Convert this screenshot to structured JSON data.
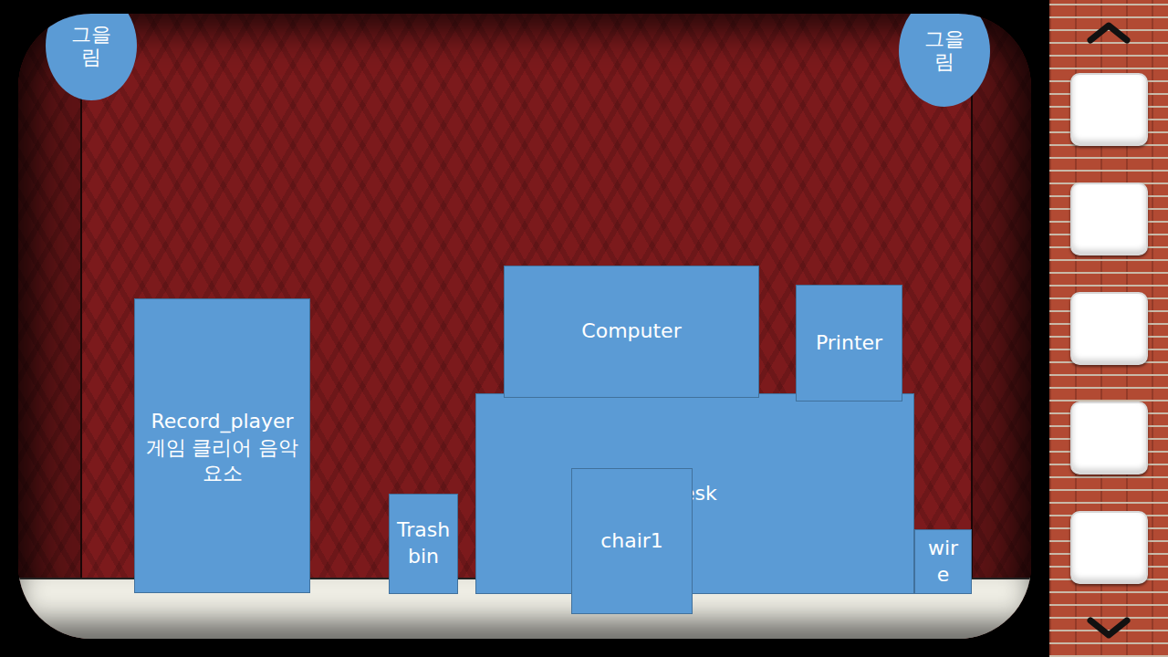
{
  "corner_marks": [
    {
      "label": "그을림"
    },
    {
      "label": "그을림"
    }
  ],
  "objects": [
    {
      "label": "Record_player 게임 클리어 음악요소"
    },
    {
      "label": "Trash bin"
    },
    {
      "label": "esk"
    },
    {
      "label": "Computer"
    },
    {
      "label": "Printer"
    },
    {
      "label": "chair1"
    },
    {
      "label": "wire"
    }
  ],
  "inventory": {
    "slots": [
      {
        "filled": false
      },
      {
        "filled": false
      },
      {
        "filled": false
      },
      {
        "filled": false
      },
      {
        "filled": false
      }
    ]
  }
}
